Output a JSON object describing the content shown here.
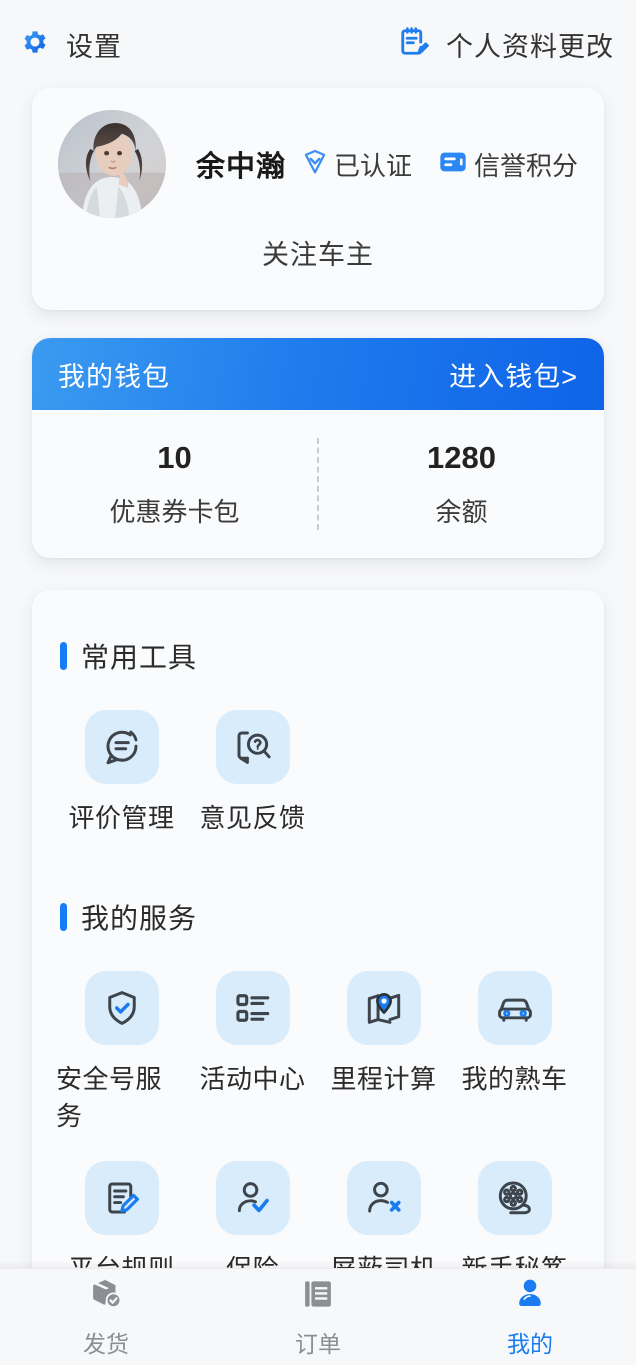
{
  "header": {
    "settings_label": "设置",
    "settings_icon": "gear-icon",
    "profile_edit_label": "个人资料更改",
    "profile_edit_icon": "edit-profile-icon"
  },
  "profile": {
    "avatar_icon": "avatar",
    "name": "余中瀚",
    "verified_label": "已认证",
    "verified_icon": "verified-shield-icon",
    "credit_label": "信誉积分",
    "credit_icon": "credit-card-icon",
    "follow_label": "关注车主"
  },
  "wallet": {
    "title": "我的钱包",
    "enter_link": "进入钱包>",
    "stats": [
      {
        "value": "10",
        "label": "优惠券卡包"
      },
      {
        "value": "1280",
        "label": "余额"
      }
    ]
  },
  "tools_section": {
    "title": "常用工具",
    "items": [
      {
        "label": "评价管理",
        "icon": "comment-lines-icon"
      },
      {
        "label": "意见反馈",
        "icon": "feedback-search-icon"
      }
    ]
  },
  "services_section": {
    "title": "我的服务",
    "items": [
      {
        "label": "安全号服务",
        "icon": "shield-check-icon"
      },
      {
        "label": "活动中心",
        "icon": "list-icon"
      },
      {
        "label": "里程计算",
        "icon": "map-pin-icon"
      },
      {
        "label": "我的熟车",
        "icon": "car-icon"
      },
      {
        "label": "平台规则",
        "icon": "document-pen-icon"
      },
      {
        "label": "保险",
        "icon": "person-check-icon"
      },
      {
        "label": "屏蔽司机",
        "icon": "person-x-icon"
      },
      {
        "label": "新手秘笈",
        "icon": "film-reel-icon"
      }
    ]
  },
  "tabbar": {
    "items": [
      {
        "label": "发货",
        "icon": "package-check-icon",
        "active": false
      },
      {
        "label": "订单",
        "icon": "order-document-icon",
        "active": false
      },
      {
        "label": "我的",
        "icon": "person-icon",
        "active": true
      }
    ]
  },
  "colors": {
    "accent": "#187cf7",
    "tile_bg": "#d9ecfb",
    "page_bg": "#f7f8fa",
    "icon_stroke": "#3d444b",
    "inactive": "#8b8f94"
  }
}
